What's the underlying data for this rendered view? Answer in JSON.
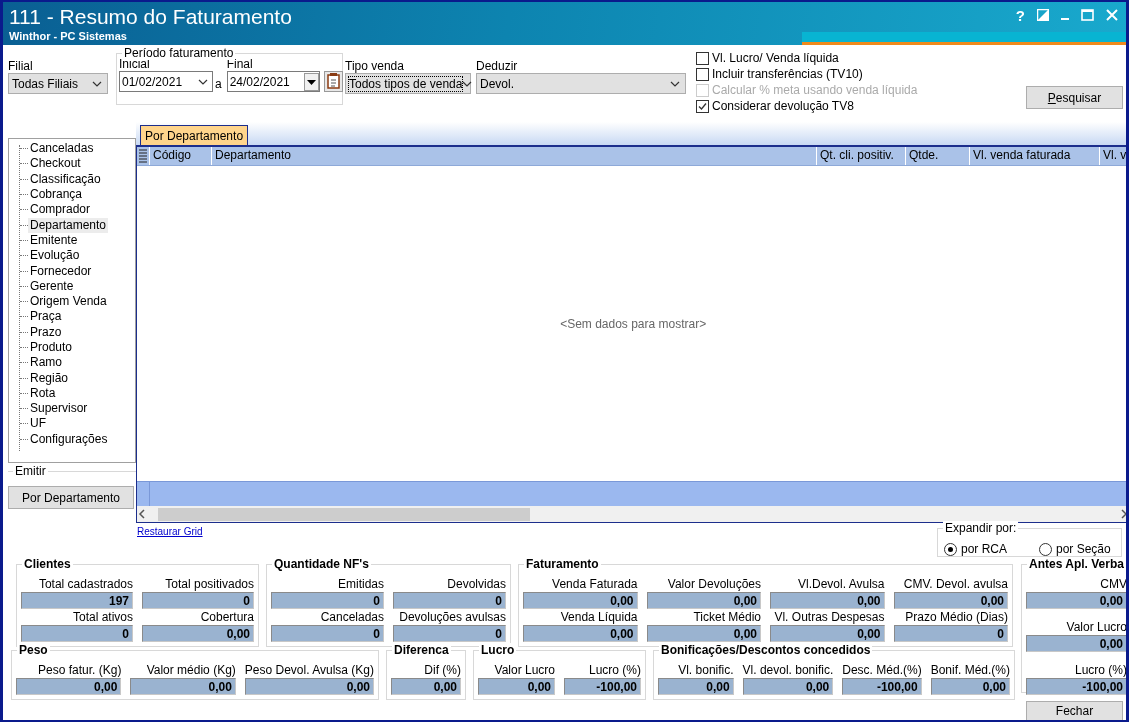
{
  "window": {
    "title": "111 - Resumo do Faturamento",
    "subtitle": "Winthor - PC Sistemas",
    "help": "?"
  },
  "filters": {
    "filial": {
      "label": "Filial",
      "value": "Todas Filiais"
    },
    "periodo": {
      "title": "Período faturamento",
      "inicial": {
        "label": "Inicial",
        "value": "01/02/2021"
      },
      "separator": "a",
      "final": {
        "label": "Final",
        "value": "24/02/2021"
      }
    },
    "tipo_venda": {
      "label": "Tipo venda",
      "value": "Todos tipos de venda"
    },
    "deduzir": {
      "label": "Deduzir",
      "value": "Devol."
    }
  },
  "options": [
    {
      "label": "Vl. Lucro/ Venda líquida",
      "checked": false,
      "disabled": false
    },
    {
      "label": "Incluir transferências  (TV10)",
      "checked": false,
      "disabled": false
    },
    {
      "label": "Calcular % meta usando venda líquida",
      "checked": false,
      "disabled": true
    },
    {
      "label": "Considerar devolução TV8",
      "checked": true,
      "disabled": false
    }
  ],
  "search_button": {
    "label": "Pesquisar"
  },
  "tree": [
    {
      "label": "Canceladas",
      "selected": false
    },
    {
      "label": "Checkout",
      "selected": false
    },
    {
      "label": "Classificação",
      "selected": false
    },
    {
      "label": "Cobrança",
      "selected": false
    },
    {
      "label": "Comprador",
      "selected": false
    },
    {
      "label": "Departamento",
      "selected": true
    },
    {
      "label": "Emitente",
      "selected": false
    },
    {
      "label": "Evolução",
      "selected": false
    },
    {
      "label": "Fornecedor",
      "selected": false
    },
    {
      "label": "Gerente",
      "selected": false
    },
    {
      "label": "Origem Venda",
      "selected": false
    },
    {
      "label": "Praça",
      "selected": false
    },
    {
      "label": "Prazo",
      "selected": false
    },
    {
      "label": "Produto",
      "selected": false
    },
    {
      "label": "Ramo",
      "selected": false
    },
    {
      "label": "Região",
      "selected": false
    },
    {
      "label": "Rota",
      "selected": false
    },
    {
      "label": "Supervisor",
      "selected": false
    },
    {
      "label": "UF",
      "selected": false
    },
    {
      "label": "Configurações",
      "selected": false
    }
  ],
  "emitir": {
    "title": "Emitir",
    "button": "Por Departamento"
  },
  "tabs": [
    {
      "label": "Por Departamento",
      "selected": true
    }
  ],
  "grid": {
    "columns": [
      "Código",
      "Departamento",
      "Qt. cli. positiv.",
      "Qtde.",
      "Vl. venda faturada",
      "Vl. v"
    ],
    "empty_text": "<Sem dados para mostrar>"
  },
  "restore_link": "Restaurar Grid",
  "expand": {
    "title": "Expandir por:",
    "options": [
      {
        "label": "por RCA",
        "selected": true
      },
      {
        "label": "por Seção",
        "selected": false
      }
    ]
  },
  "group_rows": [
    {
      "groups": [
        {
          "title": "Clientes",
          "fields": [
            {
              "label": "Total cadastrados",
              "value": "197"
            },
            {
              "label": "Total positivados",
              "value": "0"
            },
            {
              "label": "Total ativos",
              "value": "0"
            },
            {
              "label": "Cobertura",
              "value": "0,00"
            }
          ]
        },
        {
          "title": "Quantidade NF's",
          "fields": [
            {
              "label": "Emitidas",
              "value": "0"
            },
            {
              "label": "Devolvidas",
              "value": "0"
            },
            {
              "label": "Canceladas",
              "value": "0"
            },
            {
              "label": "Devoluções avulsas",
              "value": "0"
            }
          ]
        },
        {
          "title": "Faturamento",
          "fields": [
            {
              "label": "Venda Faturada",
              "value": "0,00"
            },
            {
              "label": "Valor Devoluções",
              "value": "0,00"
            },
            {
              "label": "Vl.Devol. Avulsa",
              "value": "0,00"
            },
            {
              "label": "CMV. Devol. avulsa",
              "value": "0,00"
            },
            {
              "label": "Venda Líquida",
              "value": "0,00"
            },
            {
              "label": "Ticket Médio",
              "value": "0,00"
            },
            {
              "label": "Vl. Outras Despesas",
              "value": "0,00"
            },
            {
              "label": "Prazo Médio (Dias)",
              "value": "0"
            }
          ]
        }
      ]
    },
    {
      "groups": [
        {
          "title": "Peso",
          "fields": [
            {
              "label": "Peso fatur. (Kg)",
              "value": "0,00"
            },
            {
              "label": "Valor médio (Kg)",
              "value": "0,00"
            },
            {
              "label": "Peso Devol. Avulsa (Kg)",
              "value": "0,00"
            }
          ]
        },
        {
          "title": "Diferenca",
          "fields": [
            {
              "label": "Dif (%)",
              "value": "0,00"
            }
          ]
        },
        {
          "title": "Lucro",
          "fields": [
            {
              "label": "Valor Lucro",
              "value": "0,00"
            },
            {
              "label": "Lucro (%)",
              "value": "-100,00"
            }
          ]
        },
        {
          "title": "Bonificações/Descontos concedidos",
          "fields": [
            {
              "label": "Vl. bonific.",
              "value": "0,00"
            },
            {
              "label": "Vl. devol. bonific.",
              "value": "0,00"
            },
            {
              "label": "Desc. Méd.(%)",
              "value": "-100,00"
            },
            {
              "label": "Bonif. Méd.(%)",
              "value": "0,00"
            }
          ]
        }
      ]
    }
  ],
  "side_group": {
    "title": "Antes Apl. Verba",
    "fields": [
      {
        "label": "CMV",
        "value": "0,00"
      },
      {
        "label": "Valor Lucro",
        "value": "0,00"
      },
      {
        "label": "Lucro (%)",
        "value": "-100,00"
      }
    ]
  },
  "close_button": "Fechar"
}
